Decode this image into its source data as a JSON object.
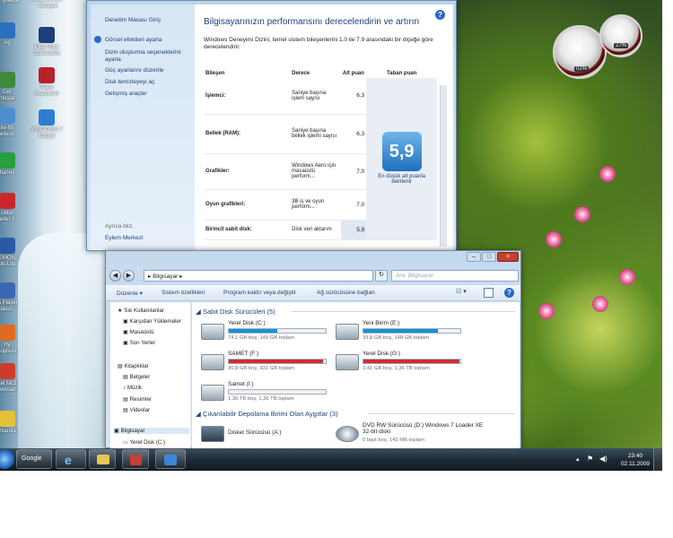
{
  "desktop": {
    "icons": [
      {
        "label": "Ag"
      },
      {
        "label": "Get\nmuşlar"
      },
      {
        "label": "ile-fin\nelleon"
      },
      {
        "label": "hamet"
      },
      {
        "label": "obbe\nerler 9"
      },
      {
        "label": "EMON\nols Lite"
      },
      {
        "label": "ia Player\nlassic"
      },
      {
        "label": "Hy\ncopress"
      },
      {
        "label": "kel Mc3\nwnload"
      },
      {
        "label": "zkarula"
      },
      {
        "label": "gisayar"
      },
      {
        "label": "Play 0512\nConvertkisi"
      },
      {
        "label": "Poker\nStandcher"
      },
      {
        "label": "WINDOWS 7\nKopyal"
      },
      {
        "label": "oreamstream\n- Kisayol"
      }
    ],
    "gadget_cpu": "02%",
    "gadget_ram": "27%"
  },
  "perf_window": {
    "nav_home": "Denetim Masası Giriş",
    "nav_links": [
      "Görsel efektleri ayarla",
      "Dizin oluşturma seçeneklerini ayarla",
      "Güç ayarlarını düzenle",
      "Disk temizleyeyi aç",
      "Gelişmiş araçlar"
    ],
    "see_also": "Ayrıca bkz.",
    "see_also_link": "Eylem Merkezi",
    "title": "Bilgisayarınızın performansını derecelendirin ve artırın",
    "description": "Windows Deneyimi Dizini, temel sistem bileşenlerini 1.0 ile 7.9 arasındaki bir ölçeğe göre derecelendirir.",
    "col_component": "Bileşen",
    "col_rating": "Derece",
    "col_subscore": "Alt puan",
    "col_basescore": "Taban puan",
    "rows": [
      {
        "component": "İşlemci:",
        "rating": "Saniye başına işlem sayısı",
        "score": "6,3"
      },
      {
        "component": "Bellek (RAM):",
        "rating": "Saniye başına bellek işlemi sayısı",
        "score": "6,3"
      },
      {
        "component": "Grafikler:",
        "rating": "Windows Aero için masaüstü perform...",
        "score": "7,0"
      },
      {
        "component": "Oyun grafikleri:",
        "rating": "3B iş ve oyun perform...",
        "score": "7,0"
      },
      {
        "component": "Birincil sabit disk:",
        "rating": "Disk veri aktarım",
        "score": "5,9"
      }
    ],
    "base_score": "5,9",
    "base_caption": "En düşük alt puanla belirlenir"
  },
  "explorer": {
    "address": "Bilgisayar",
    "search_placeholder": "Ara: Bilgisayar",
    "commands": [
      "Düzenle ▾",
      "Sistem özellikleri",
      "Program kaldır veya değiştir",
      "Ağ sürücüsüne bağlan"
    ],
    "nav": [
      "Sık Kullanılanlar",
      "Karşıdan Yüklemeler",
      "Masaüstü",
      "Son Yerler",
      "Kitaplıklar",
      "Belgeler",
      "Müzik",
      "Resimler",
      "Videolar",
      "Bilgisayar",
      "Yerel Disk (C:)"
    ],
    "group1": "Sabit Disk Sürücüleri (5)",
    "group2": "Çıkarılabilir Depolama Birimi Olan Aygıtlar (3)",
    "drives": [
      {
        "name": "Yerel Disk (C:)",
        "info": "74,1 GB boş, 149 GB toplam",
        "fill": 0.5,
        "color": "#1a8fd6"
      },
      {
        "name": "Yeni Birim (E:)",
        "info": "33,8 GB boş, 148 GB toplam",
        "fill": 0.77,
        "color": "#1a8fd6"
      },
      {
        "name": "SAMET (F:)",
        "info": "30,8 GB boş, 931 GB toplam",
        "fill": 0.97,
        "color": "#d62a2a"
      },
      {
        "name": "Yerel Disk (G:)",
        "info": "3,41 GB boş, 1,36 TB toplam",
        "fill": 0.99,
        "color": "#d62a2a"
      },
      {
        "name": "Samet (I:)",
        "info": "1,36 TB boş, 1,36 TB toplam",
        "fill": 0.0,
        "color": "#1a8fd6"
      }
    ],
    "removables": [
      {
        "name": "Disket Sürücüsü (A:)",
        "info": ""
      },
      {
        "name": "DVD RW Sürücüsü (D:) Windows 7 Loader XE 32-bit diski",
        "info": "0 bayt boş, 142 MB toplam"
      }
    ]
  },
  "taskbar": {
    "google": "Google",
    "time": "23:40",
    "date": "02.11.2009"
  }
}
